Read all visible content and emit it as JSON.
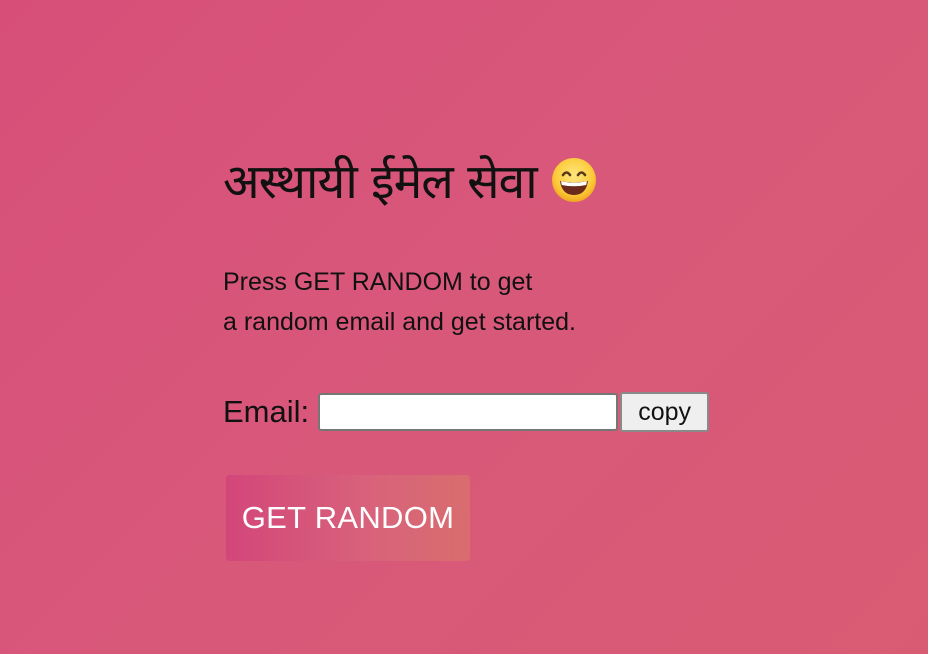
{
  "header": {
    "title": "अस्थायी ईमेल सेवा",
    "emoji_icon": "grinning-face-icon"
  },
  "intro": {
    "line1": "Press GET RANDOM to get",
    "line2": "a random email and get started."
  },
  "email": {
    "label": "Email:",
    "value": "",
    "placeholder": "",
    "copy_label": "copy"
  },
  "actions": {
    "get_random_label": "GET RANDOM"
  },
  "colors": {
    "background_start": "#d74f79",
    "background_end": "#d95b73",
    "button_start": "#d3467a",
    "button_end": "#d96d6e"
  }
}
